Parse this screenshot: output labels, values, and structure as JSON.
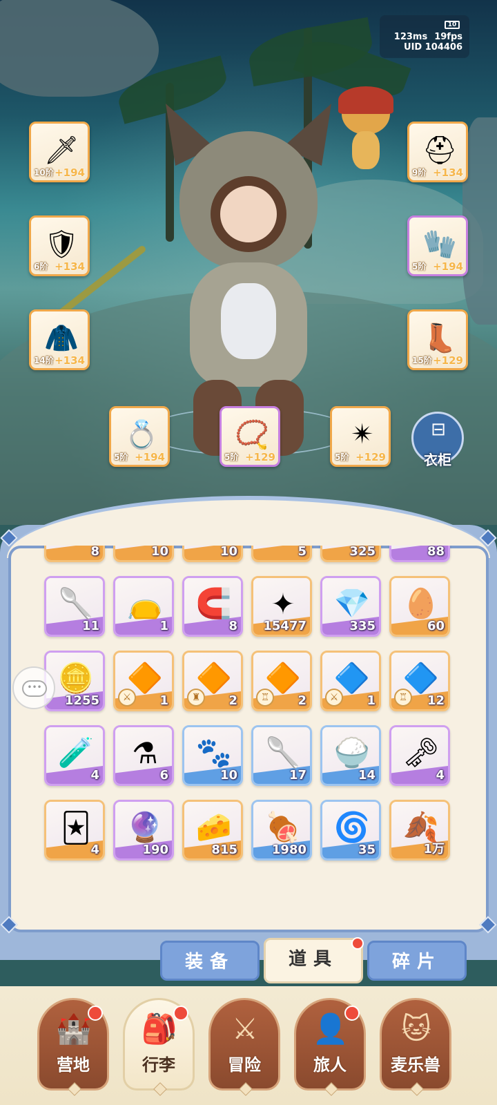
{
  "status": {
    "battery": "10",
    "ping": "123ms",
    "fps": "19fps",
    "uid": "UID 104406"
  },
  "equipment": {
    "left": [
      {
        "icon": "spear-icon",
        "glyph": "🗡",
        "tier": "10阶",
        "bonus": "+194",
        "rarity": "orange"
      },
      {
        "icon": "armor-icon",
        "glyph": "🛡",
        "tier": "6阶",
        "bonus": "+134",
        "rarity": "orange"
      },
      {
        "icon": "robe-icon",
        "glyph": "🧥",
        "tier": "14阶",
        "bonus": "+134",
        "rarity": "orange"
      }
    ],
    "right": [
      {
        "icon": "helmet-icon",
        "glyph": "⛑",
        "tier": "9阶",
        "bonus": "+134",
        "rarity": "orange"
      },
      {
        "icon": "gauntlet-icon",
        "glyph": "🧤",
        "tier": "5阶",
        "bonus": "+194",
        "rarity": "purple"
      },
      {
        "icon": "boots-icon",
        "glyph": "👢",
        "tier": "15阶",
        "bonus": "+129",
        "rarity": "orange"
      }
    ],
    "bottom": [
      {
        "icon": "ring-icon",
        "glyph": "💍",
        "tier": "5阶",
        "bonus": "+194",
        "rarity": "orange"
      },
      {
        "icon": "necklace-icon",
        "glyph": "📿",
        "tier": "5阶",
        "bonus": "+129",
        "rarity": "purple"
      },
      {
        "icon": "pendant-icon",
        "glyph": "✴",
        "tier": "5阶",
        "bonus": "+129",
        "rarity": "orange"
      }
    ]
  },
  "wardrobe": {
    "label": "衣柜"
  },
  "inventory": {
    "partial_row": [
      "8",
      "10",
      "10",
      "5",
      "325",
      "88"
    ],
    "rows": [
      [
        {
          "icon": "cat-spoon-icon",
          "glyph": "🥄",
          "count": "11",
          "rarity": "purple"
        },
        {
          "icon": "paw-sack-icon",
          "glyph": "👝",
          "count": "1",
          "rarity": "purple"
        },
        {
          "icon": "horseshoe-icon",
          "glyph": "🧲",
          "count": "8",
          "rarity": "purple"
        },
        {
          "icon": "star-crystal-icon",
          "glyph": "✦",
          "count": "15477",
          "rarity": "orange"
        },
        {
          "icon": "purple-gem-icon",
          "glyph": "💎",
          "count": "335",
          "rarity": "purple"
        },
        {
          "icon": "amber-egg-icon",
          "glyph": "🥚",
          "count": "60",
          "rarity": "orange"
        }
      ],
      [
        {
          "icon": "heart-coin-icon",
          "glyph": "🪙",
          "count": "1255",
          "rarity": "purple"
        },
        {
          "icon": "fire-crystal-sword-icon",
          "glyph": "🔶",
          "count": "1",
          "rarity": "orange",
          "tag": "⚔"
        },
        {
          "icon": "fire-crystal-armor-icon",
          "glyph": "🔶",
          "count": "2",
          "rarity": "orange",
          "tag": "♜"
        },
        {
          "icon": "fire-crystal-scroll-icon",
          "glyph": "🔶",
          "count": "2",
          "rarity": "orange",
          "tag": "♖"
        },
        {
          "icon": "ice-crystal-sword-icon",
          "glyph": "🔷",
          "count": "1",
          "rarity": "orange",
          "tag": "⚔"
        },
        {
          "icon": "ice-crystal-ring-icon",
          "glyph": "🔷",
          "count": "12",
          "rarity": "orange",
          "tag": "♖"
        }
      ],
      [
        {
          "icon": "blue-potion-icon",
          "glyph": "🧪",
          "count": "4",
          "rarity": "purple"
        },
        {
          "icon": "red-potion-icon",
          "glyph": "⚗",
          "count": "6",
          "rarity": "purple"
        },
        {
          "icon": "pink-paw-icon",
          "glyph": "🐾",
          "count": "10",
          "rarity": "blue"
        },
        {
          "icon": "wooden-spoon-icon",
          "glyph": "🥄",
          "count": "17",
          "rarity": "blue"
        },
        {
          "icon": "rice-bowl-icon",
          "glyph": "🍚",
          "count": "14",
          "rarity": "blue"
        },
        {
          "icon": "golden-key-icon",
          "glyph": "🗝",
          "count": "4",
          "rarity": "purple"
        }
      ],
      [
        {
          "icon": "eye-card-icon",
          "glyph": "🃏",
          "count": "4",
          "rarity": "orange"
        },
        {
          "icon": "cat-mirror-icon",
          "glyph": "🔮",
          "count": "190",
          "rarity": "purple"
        },
        {
          "icon": "cheese-icon",
          "glyph": "🧀",
          "count": "815",
          "rarity": "orange"
        },
        {
          "icon": "meat-icon",
          "glyph": "🍖",
          "count": "1980",
          "rarity": "blue"
        },
        {
          "icon": "water-orb-icon",
          "glyph": "🌀",
          "count": "35",
          "rarity": "blue"
        },
        {
          "icon": "golden-leaf-icon",
          "glyph": "🍂",
          "count": "1万",
          "rarity": "orange"
        }
      ]
    ]
  },
  "tabs": [
    {
      "label": "装备",
      "active": false
    },
    {
      "label": "道具",
      "active": true,
      "badge": true
    },
    {
      "label": "碎片",
      "active": false
    }
  ],
  "nav": [
    {
      "label": "营地",
      "icon": "castle-icon",
      "glyph": "🏰",
      "badge": true
    },
    {
      "label": "行李",
      "icon": "backpack-icon",
      "glyph": "🎒",
      "badge": true,
      "active": true
    },
    {
      "label": "冒险",
      "icon": "crossed-swords-icon",
      "glyph": "⚔",
      "badge": false
    },
    {
      "label": "旅人",
      "icon": "traveler-icon",
      "glyph": "👤",
      "badge": true
    },
    {
      "label": "麦乐兽",
      "icon": "beast-icon",
      "glyph": "🐱",
      "badge": false
    }
  ]
}
